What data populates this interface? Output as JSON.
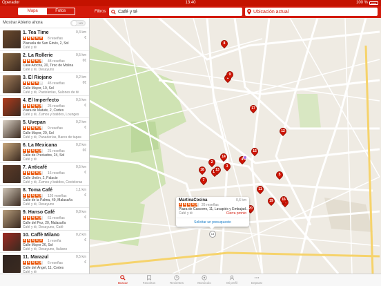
{
  "status": {
    "carrier": "Operador",
    "time": "13:40",
    "battery": "100 %"
  },
  "header": {
    "tabs": [
      {
        "label": "Mapa",
        "active": true
      },
      {
        "label": "Fotos",
        "active": false
      }
    ],
    "filters": "Filtros",
    "search_value": "Café y té",
    "location_value": "Ubicación actual"
  },
  "list": {
    "open_now": "Mostrar Abierto ahora",
    "toggle": "NO",
    "items": [
      {
        "title": "1. Tea Time",
        "distance": "0,3 km",
        "rating": 5,
        "reviews": "8 reseñas",
        "price": "€",
        "address": "Plazuela de San Ginés, 2, Sol",
        "category": "Café y té",
        "thumb": "#6b4a2d"
      },
      {
        "title": "2. La Rollerie",
        "distance": "0,5 km",
        "rating": 4.5,
        "reviews": "48 reseñas",
        "price": "€€",
        "address": "Calle Atocha, 20, Tirso de Molina",
        "category": "Café y té, Desayuno",
        "thumb": "#8a6a45"
      },
      {
        "title": "3. El Riojano",
        "distance": "0,2 km",
        "rating": 4,
        "reviews": "45 reseñas",
        "price": "€€",
        "address": "Calle Mayor, 10, Sol",
        "category": "Café y té, Pastelerías, Salones de té",
        "thumb": "#a27d5a"
      },
      {
        "title": "4. El Imperfecto",
        "distance": "0,5 km",
        "rating": 4.5,
        "reviews": "25 reseñas",
        "price": "€",
        "address": "Plaza de Matute, 2, Cortes",
        "category": "Café y té, Zumos y batidos, Lounges",
        "thumb": "#b13b1c"
      },
      {
        "title": "5. Uvepan",
        "distance": "0,2 km",
        "rating": 4.5,
        "reviews": "9 reseñas",
        "price": "€",
        "address": "Calle Mayor, 29, Sol",
        "category": "Café y té, Panaderías, Bares de tapas",
        "thumb": "#d9d0c4"
      },
      {
        "title": "6. La Mexicana",
        "distance": "0,2 km",
        "rating": 4.5,
        "reviews": "21 reseñas",
        "price": "€€",
        "address": "Calle de Preciados, 24, Sol",
        "category": "Café y té",
        "thumb": "#c9a87d"
      },
      {
        "title": "7. Anticafé",
        "distance": "0,5 km",
        "rating": 4.5,
        "reviews": "16 reseñas",
        "price": "€",
        "address": "Calle Unión, 2, Palacio",
        "category": "Café y té, Zumos y batidos, Cocteleras",
        "thumb": "#5d3b28"
      },
      {
        "title": "8. Toma Café",
        "distance": "1,1 km",
        "rating": 4.5,
        "reviews": "126 reseñas",
        "price": "€",
        "address": "Calle de la Palma, 49, Malasaña",
        "category": "Café y té, Desayuno",
        "thumb": "#cfc5b6"
      },
      {
        "title": "9. Hanso Café",
        "distance": "0,8 km",
        "rating": 4.5,
        "reviews": "61 reseñas",
        "price": "€",
        "address": "Calle del Pez, 20, Malasaña",
        "category": "Café y té, Desayuno, Café",
        "thumb": "#b59c7b"
      },
      {
        "title": "10. Caffè Milano",
        "distance": "0,2 km",
        "rating": 5,
        "reviews": "1 reseña",
        "price": "€",
        "address": "Calle Mayor 26, Sol",
        "category": "Café y té, Desayuno, Italiano",
        "thumb": "#9e2a22"
      },
      {
        "title": "11. Marazul",
        "distance": "0,5 km",
        "rating": 4.5,
        "reviews": "6 reseñas",
        "price": "€",
        "address": "Calle del Ángel, 11, Cortes",
        "category": "Café y té",
        "thumb": "#2f2420"
      }
    ]
  },
  "map": {
    "pins": [
      "1",
      "2",
      "3",
      "4",
      "5",
      "6",
      "7",
      "8",
      "9",
      "10",
      "11",
      "12",
      "13",
      "14",
      "15",
      "16",
      "17",
      "18",
      "19",
      "20"
    ],
    "badge": "13",
    "popup": {
      "name": "MartinaCocina",
      "distance": "0,6 km",
      "rating": 4.5,
      "reviews": "26 reseñas",
      "address": "Plaza de Cascorro, 11, Lavapiés y Embajad...",
      "category": "Café y té",
      "open": "Cierra pronto",
      "cta": "Solicitar un presupuesto"
    }
  },
  "tabbar": [
    {
      "label": "Buscar",
      "icon": "search-icon",
      "active": true
    },
    {
      "label": "Favoritos",
      "icon": "bookmark-icon"
    },
    {
      "label": "Recientes",
      "icon": "clock-icon"
    },
    {
      "label": "Monóculo",
      "icon": "monocle-icon"
    },
    {
      "label": "Mi perfil",
      "icon": "profile-icon"
    },
    {
      "label": "Deparar",
      "icon": "more-icon"
    }
  ],
  "colors": {
    "brand": "#d31a0b",
    "star": "#e85000",
    "pin": "#d21504"
  }
}
